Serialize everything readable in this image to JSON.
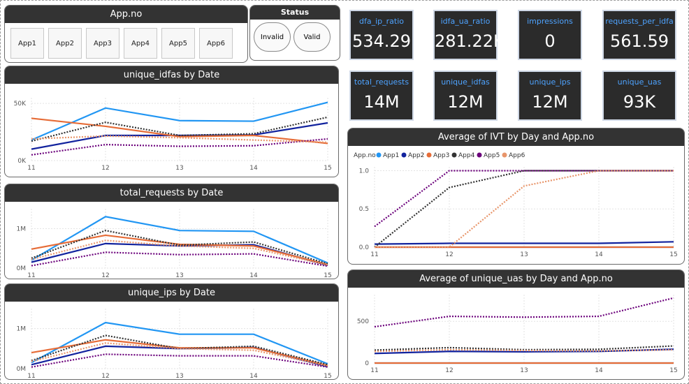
{
  "slicers": {
    "app": {
      "title": "App.no",
      "items": [
        "App1",
        "App2",
        "App3",
        "App4",
        "App5",
        "App6"
      ]
    },
    "status": {
      "title": "Status",
      "items": [
        "Invalid",
        "Valid"
      ]
    }
  },
  "kpis": [
    {
      "label": "dfa_ip_ratio",
      "value": "534.29"
    },
    {
      "label": "idfa_ua_ratio",
      "value": "281.22K"
    },
    {
      "label": "impressions",
      "value": "0"
    },
    {
      "label": "requests_per_idfa",
      "value": "561.59"
    },
    {
      "label": "total_requests",
      "value": "14M"
    },
    {
      "label": "unique_idfas",
      "value": "12M"
    },
    {
      "label": "unique_ips",
      "value": "12M"
    },
    {
      "label": "unique_uas",
      "value": "93K"
    }
  ],
  "colors": {
    "App1": "#2196f3",
    "App2": "#12239e",
    "App3": "#e66c37",
    "App4": "#333333",
    "App5": "#6b007b",
    "App6": "#e8956a"
  },
  "chart_data": [
    {
      "type": "line",
      "title": "unique_idfas by Date",
      "x": [
        11,
        12,
        13,
        14,
        15
      ],
      "yticks": [
        "50K",
        "0K"
      ],
      "ylim": [
        0,
        55000
      ],
      "yticks_values": [
        50000,
        0
      ],
      "series": [
        {
          "name": "App1",
          "values": [
            18000,
            46000,
            35000,
            34500,
            51000
          ]
        },
        {
          "name": "App2",
          "values": [
            10000,
            22000,
            22000,
            22500,
            33000
          ]
        },
        {
          "name": "App3",
          "values": [
            37000,
            30000,
            21000,
            22000,
            15000
          ]
        },
        {
          "name": "App4",
          "values": [
            17000,
            33500,
            22000,
            23500,
            38000
          ]
        },
        {
          "name": "App5",
          "values": [
            5000,
            14000,
            12500,
            13000,
            19000
          ]
        },
        {
          "name": "App6",
          "values": [
            19000,
            21500,
            20000,
            18000,
            16000
          ]
        }
      ]
    },
    {
      "type": "line",
      "title": "total_requests by Date",
      "x": [
        11,
        12,
        13,
        14,
        15
      ],
      "yticks": [
        "1M",
        "0M"
      ],
      "ylim": [
        0,
        1500000
      ],
      "yticks_values": [
        1000000,
        0
      ],
      "series": [
        {
          "name": "App1",
          "values": [
            200000,
            1300000,
            950000,
            930000,
            130000
          ]
        },
        {
          "name": "App2",
          "values": [
            150000,
            620000,
            560000,
            590000,
            70000
          ]
        },
        {
          "name": "App3",
          "values": [
            480000,
            830000,
            600000,
            560000,
            90000
          ]
        },
        {
          "name": "App4",
          "values": [
            250000,
            950000,
            580000,
            660000,
            110000
          ]
        },
        {
          "name": "App5",
          "values": [
            60000,
            400000,
            340000,
            360000,
            50000
          ]
        },
        {
          "name": "App6",
          "values": [
            220000,
            700000,
            560000,
            500000,
            80000
          ]
        }
      ]
    },
    {
      "type": "line",
      "title": "unique_ips by Date",
      "x": [
        11,
        12,
        13,
        14,
        15
      ],
      "yticks": [
        "1M",
        "0M"
      ],
      "ylim": [
        0,
        1500000
      ],
      "yticks_values": [
        1000000,
        0
      ],
      "series": [
        {
          "name": "App1",
          "values": [
            150000,
            1150000,
            860000,
            860000,
            120000
          ]
        },
        {
          "name": "App2",
          "values": [
            100000,
            560000,
            500000,
            530000,
            50000
          ]
        },
        {
          "name": "App3",
          "values": [
            400000,
            720000,
            520000,
            520000,
            80000
          ]
        },
        {
          "name": "App4",
          "values": [
            200000,
            830000,
            500000,
            560000,
            100000
          ]
        },
        {
          "name": "App5",
          "values": [
            40000,
            360000,
            320000,
            320000,
            40000
          ]
        },
        {
          "name": "App6",
          "values": [
            180000,
            640000,
            500000,
            460000,
            70000
          ]
        }
      ]
    },
    {
      "type": "line",
      "title": "Average of IVT by Day and App.no",
      "legend_label": "App.no",
      "legend_position": "top-left",
      "x": [
        11,
        12,
        13,
        14,
        15
      ],
      "yticks": [
        "1.0",
        "0.5",
        "0.0"
      ],
      "ylim": [
        0,
        1.05
      ],
      "yticks_values": [
        1.0,
        0.5,
        0.0
      ],
      "series": [
        {
          "name": "App1",
          "values": [
            0.0,
            0.0,
            0.0,
            0.0,
            0.0
          ]
        },
        {
          "name": "App2",
          "values": [
            0.04,
            0.05,
            0.05,
            0.05,
            0.07
          ]
        },
        {
          "name": "App3",
          "values": [
            0.0,
            0.0,
            0.0,
            0.0,
            0.0
          ]
        },
        {
          "name": "App4",
          "values": [
            0.0,
            0.78,
            1.0,
            1.0,
            1.0
          ]
        },
        {
          "name": "App5",
          "values": [
            0.27,
            1.0,
            1.0,
            1.0,
            1.0
          ]
        },
        {
          "name": "App6",
          "values": [
            0.0,
            0.0,
            0.8,
            1.0,
            1.0
          ]
        }
      ]
    },
    {
      "type": "line",
      "title": "Average of unique_uas by Day and App.no",
      "x": [
        11,
        12,
        13,
        14,
        15
      ],
      "yticks": [
        "500",
        "0"
      ],
      "ylim": [
        0,
        820
      ],
      "yticks_values": [
        500,
        0
      ],
      "series": [
        {
          "name": "App1",
          "values": [
            0,
            0,
            0,
            0,
            0
          ]
        },
        {
          "name": "App2",
          "values": [
            115,
            140,
            135,
            140,
            165
          ]
        },
        {
          "name": "App3",
          "values": [
            0,
            0,
            0,
            0,
            0
          ]
        },
        {
          "name": "App4",
          "values": [
            155,
            185,
            160,
            165,
            205
          ]
        },
        {
          "name": "App5",
          "values": [
            435,
            560,
            550,
            560,
            780
          ]
        },
        {
          "name": "App6",
          "values": [
            140,
            160,
            150,
            145,
            160
          ]
        }
      ]
    }
  ]
}
